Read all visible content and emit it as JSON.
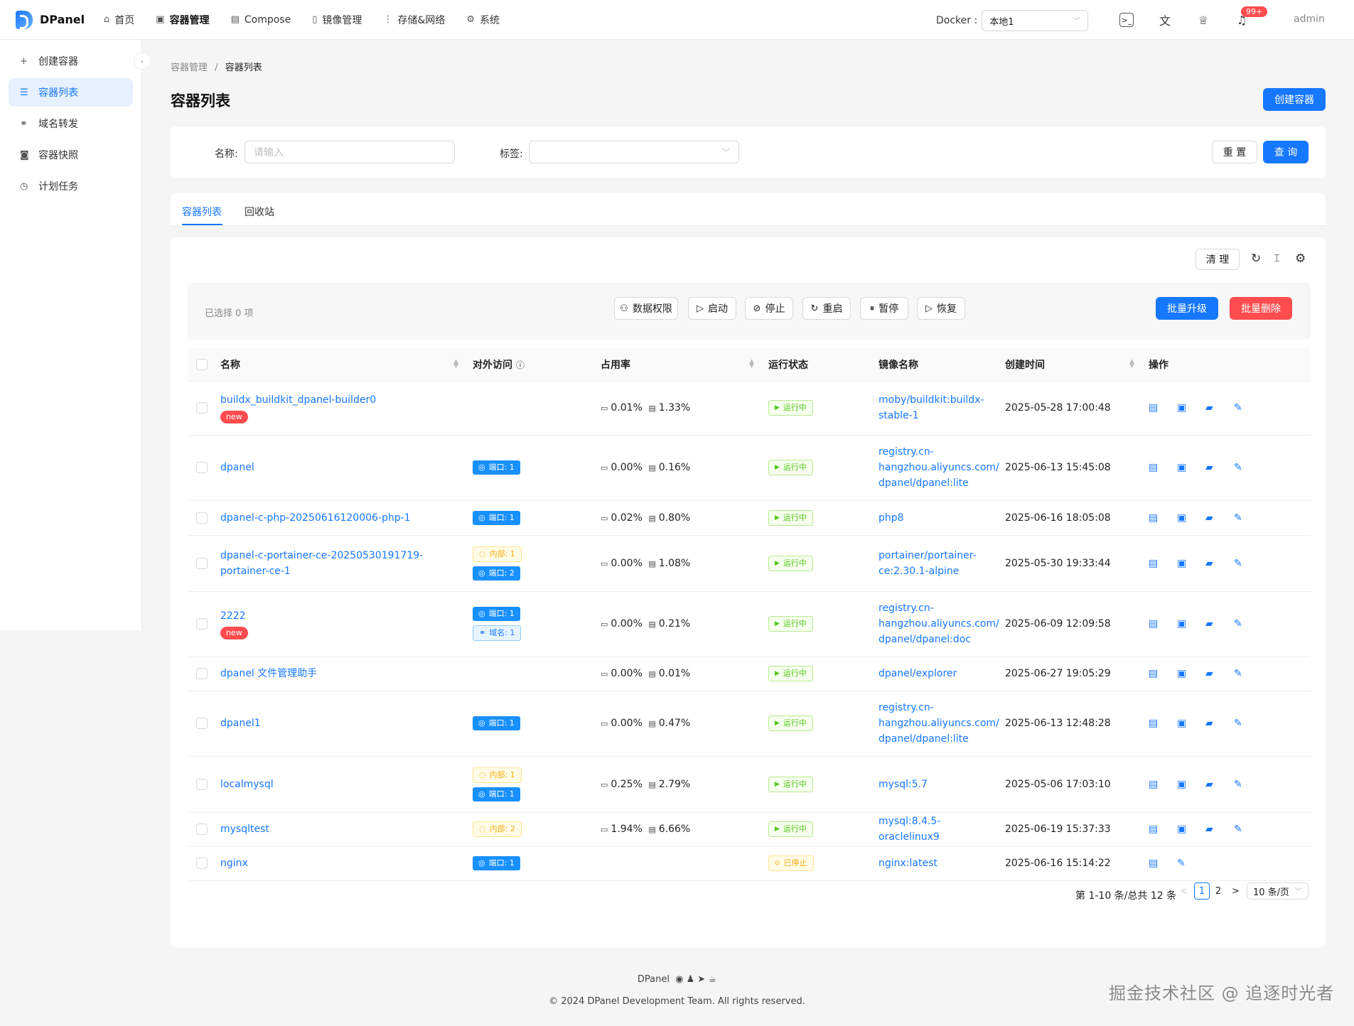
{
  "app": {
    "name": "DPanel"
  },
  "nav": [
    {
      "icon": "home-icon",
      "glyph": "⌂",
      "label": "首页"
    },
    {
      "icon": "container-icon",
      "glyph": "▣",
      "label": "容器管理",
      "active": true
    },
    {
      "icon": "compose-icon",
      "glyph": "▤",
      "label": "Compose"
    },
    {
      "icon": "file-icon",
      "glyph": "▯",
      "label": "镜像管理"
    },
    {
      "icon": "more-icon",
      "glyph": "⋮",
      "label": "存储&网络"
    },
    {
      "icon": "gear-icon",
      "glyph": "⚙",
      "label": "系统"
    }
  ],
  "docker": {
    "label": "Docker :",
    "value": "本地1"
  },
  "notifications": {
    "badge": "99+"
  },
  "user": {
    "name": "admin"
  },
  "sidebar": [
    {
      "icon": "plus-icon",
      "glyph": "+",
      "label": "创建容器"
    },
    {
      "icon": "list-icon",
      "glyph": "☰",
      "label": "容器列表",
      "active": true
    },
    {
      "icon": "link-icon",
      "glyph": "⚭",
      "label": "域名转发"
    },
    {
      "icon": "camera-icon",
      "glyph": "◙",
      "label": "容器快照"
    },
    {
      "icon": "clock-icon",
      "glyph": "◷",
      "label": "计划任务"
    }
  ],
  "breadcrumb": {
    "parent": "容器管理",
    "sep": "/",
    "current": "容器列表"
  },
  "page": {
    "title": "容器列表",
    "create_label": "创建容器"
  },
  "search": {
    "name_label": "名称:",
    "name_placeholder": "请输入",
    "tag_label": "标签:",
    "reset_label": "重 置",
    "query_label": "查 询"
  },
  "tabs": [
    {
      "label": "容器列表",
      "active": true
    },
    {
      "label": "回收站"
    }
  ],
  "toolbar": {
    "clean_label": "清 理"
  },
  "batch": {
    "selected_text": "已选择  0  项",
    "buttons": [
      {
        "icon": "user-icon",
        "glyph": "⚇",
        "label": "数据权限"
      },
      {
        "icon": "play-icon",
        "glyph": "▷",
        "label": "启动"
      },
      {
        "icon": "stop-icon",
        "glyph": "⊘",
        "label": "停止"
      },
      {
        "icon": "restart-icon",
        "glyph": "↻",
        "label": "重启"
      },
      {
        "icon": "pause-icon",
        "glyph": "⏸",
        "label": "暂停"
      },
      {
        "icon": "resume-icon",
        "glyph": "▷",
        "label": "恢复"
      }
    ],
    "upgrade_label": "批量升级",
    "delete_label": "批量删除"
  },
  "table": {
    "columns": [
      "名称",
      "对外访问",
      "占用率",
      "运行状态",
      "镜像名称",
      "创建时间",
      "操作"
    ],
    "rows": [
      {
        "name": "buildx_buildkit_dpanel-builder0",
        "new": "new",
        "ports": [],
        "cpu": "0.01%",
        "mem": "1.33%",
        "status": "运行中",
        "running": true,
        "image": [
          "moby/buildkit:buildx-",
          "stable-1"
        ],
        "created": "2025-05-28 17:00:48",
        "h": 76
      },
      {
        "name": "dpanel",
        "ports": [
          {
            "type": "port",
            "label": "端口: 1"
          }
        ],
        "cpu": "0.00%",
        "mem": "0.16%",
        "status": "运行中",
        "running": true,
        "image": [
          "registry.cn-",
          "hangzhou.aliyuncs.com/",
          "dpanel/dpanel:lite"
        ],
        "created": "2025-06-13 15:45:08",
        "h": 92
      },
      {
        "name": "dpanel-c-php-20250616120006-php-1",
        "ports": [
          {
            "type": "port",
            "label": "端口: 1"
          }
        ],
        "cpu": "0.02%",
        "mem": "0.80%",
        "status": "运行中",
        "running": true,
        "image": [
          "php8"
        ],
        "created": "2025-06-16 18:05:08",
        "h": 49
      },
      {
        "name": "dpanel-c-portainer-ce-20250530191719-portainer-ce-1",
        "ports": [
          {
            "type": "inner",
            "label": "内部: 1"
          },
          {
            "type": "port",
            "label": "端口: 2"
          }
        ],
        "cpu": "0.00%",
        "mem": "1.08%",
        "status": "运行中",
        "running": true,
        "image": [
          "portainer/portainer-",
          "ce:2.30.1-alpine"
        ],
        "created": "2025-05-30 19:33:44",
        "h": 79
      },
      {
        "name": "2222",
        "new": "new",
        "ports": [
          {
            "type": "port",
            "label": "端口: 1"
          },
          {
            "type": "domain",
            "label": "域名: 1"
          }
        ],
        "cpu": "0.00%",
        "mem": "0.21%",
        "status": "运行中",
        "running": true,
        "image": [
          "registry.cn-",
          "hangzhou.aliyuncs.com/",
          "dpanel/dpanel:doc"
        ],
        "created": "2025-06-09 12:09:58",
        "h": 92
      },
      {
        "name": "dpanel 文件管理助手",
        "ports": [],
        "cpu": "0.00%",
        "mem": "0.01%",
        "status": "运行中",
        "running": true,
        "image": [
          "dpanel/explorer"
        ],
        "created": "2025-06-27 19:05:29",
        "h": 48
      },
      {
        "name": "dpanel1",
        "ports": [
          {
            "type": "port",
            "label": "端口: 1"
          }
        ],
        "cpu": "0.00%",
        "mem": "0.47%",
        "status": "运行中",
        "running": true,
        "image": [
          "registry.cn-",
          "hangzhou.aliyuncs.com/",
          "dpanel/dpanel:lite"
        ],
        "created": "2025-06-13 12:48:28",
        "h": 92
      },
      {
        "name": "localmysql",
        "ports": [
          {
            "type": "inner",
            "label": "内部: 1"
          },
          {
            "type": "port",
            "label": "端口: 1"
          }
        ],
        "cpu": "0.25%",
        "mem": "2.79%",
        "status": "运行中",
        "running": true,
        "image": [
          "mysql:5.7"
        ],
        "created": "2025-05-06 17:03:10",
        "h": 79
      },
      {
        "name": "mysqltest",
        "ports": [
          {
            "type": "inner",
            "label": "内部: 2"
          }
        ],
        "cpu": "1.94%",
        "mem": "6.66%",
        "status": "运行中",
        "running": true,
        "image": [
          "mysql:8.4.5-oraclelinux9"
        ],
        "created": "2025-06-19 15:37:33",
        "h": 48
      },
      {
        "name": "nginx",
        "ports": [
          {
            "type": "port",
            "label": "端口: 1"
          }
        ],
        "cpu": "",
        "mem": "",
        "status": "已停止",
        "running": false,
        "image": [
          "nginx:latest"
        ],
        "created": "2025-06-16 15:14:22",
        "h": 48
      }
    ]
  },
  "pagination": {
    "summary": "第 1-10 条/总共 12 条",
    "prev": "<",
    "pages": [
      "1",
      "2"
    ],
    "next": ">",
    "page_size": "10 条/页"
  },
  "footer": {
    "brand": "DPanel",
    "copyright": "© 2024 DPanel Development Team. All rights reserved."
  },
  "watermark": "掘金技术社区 @ 追逐时光者"
}
